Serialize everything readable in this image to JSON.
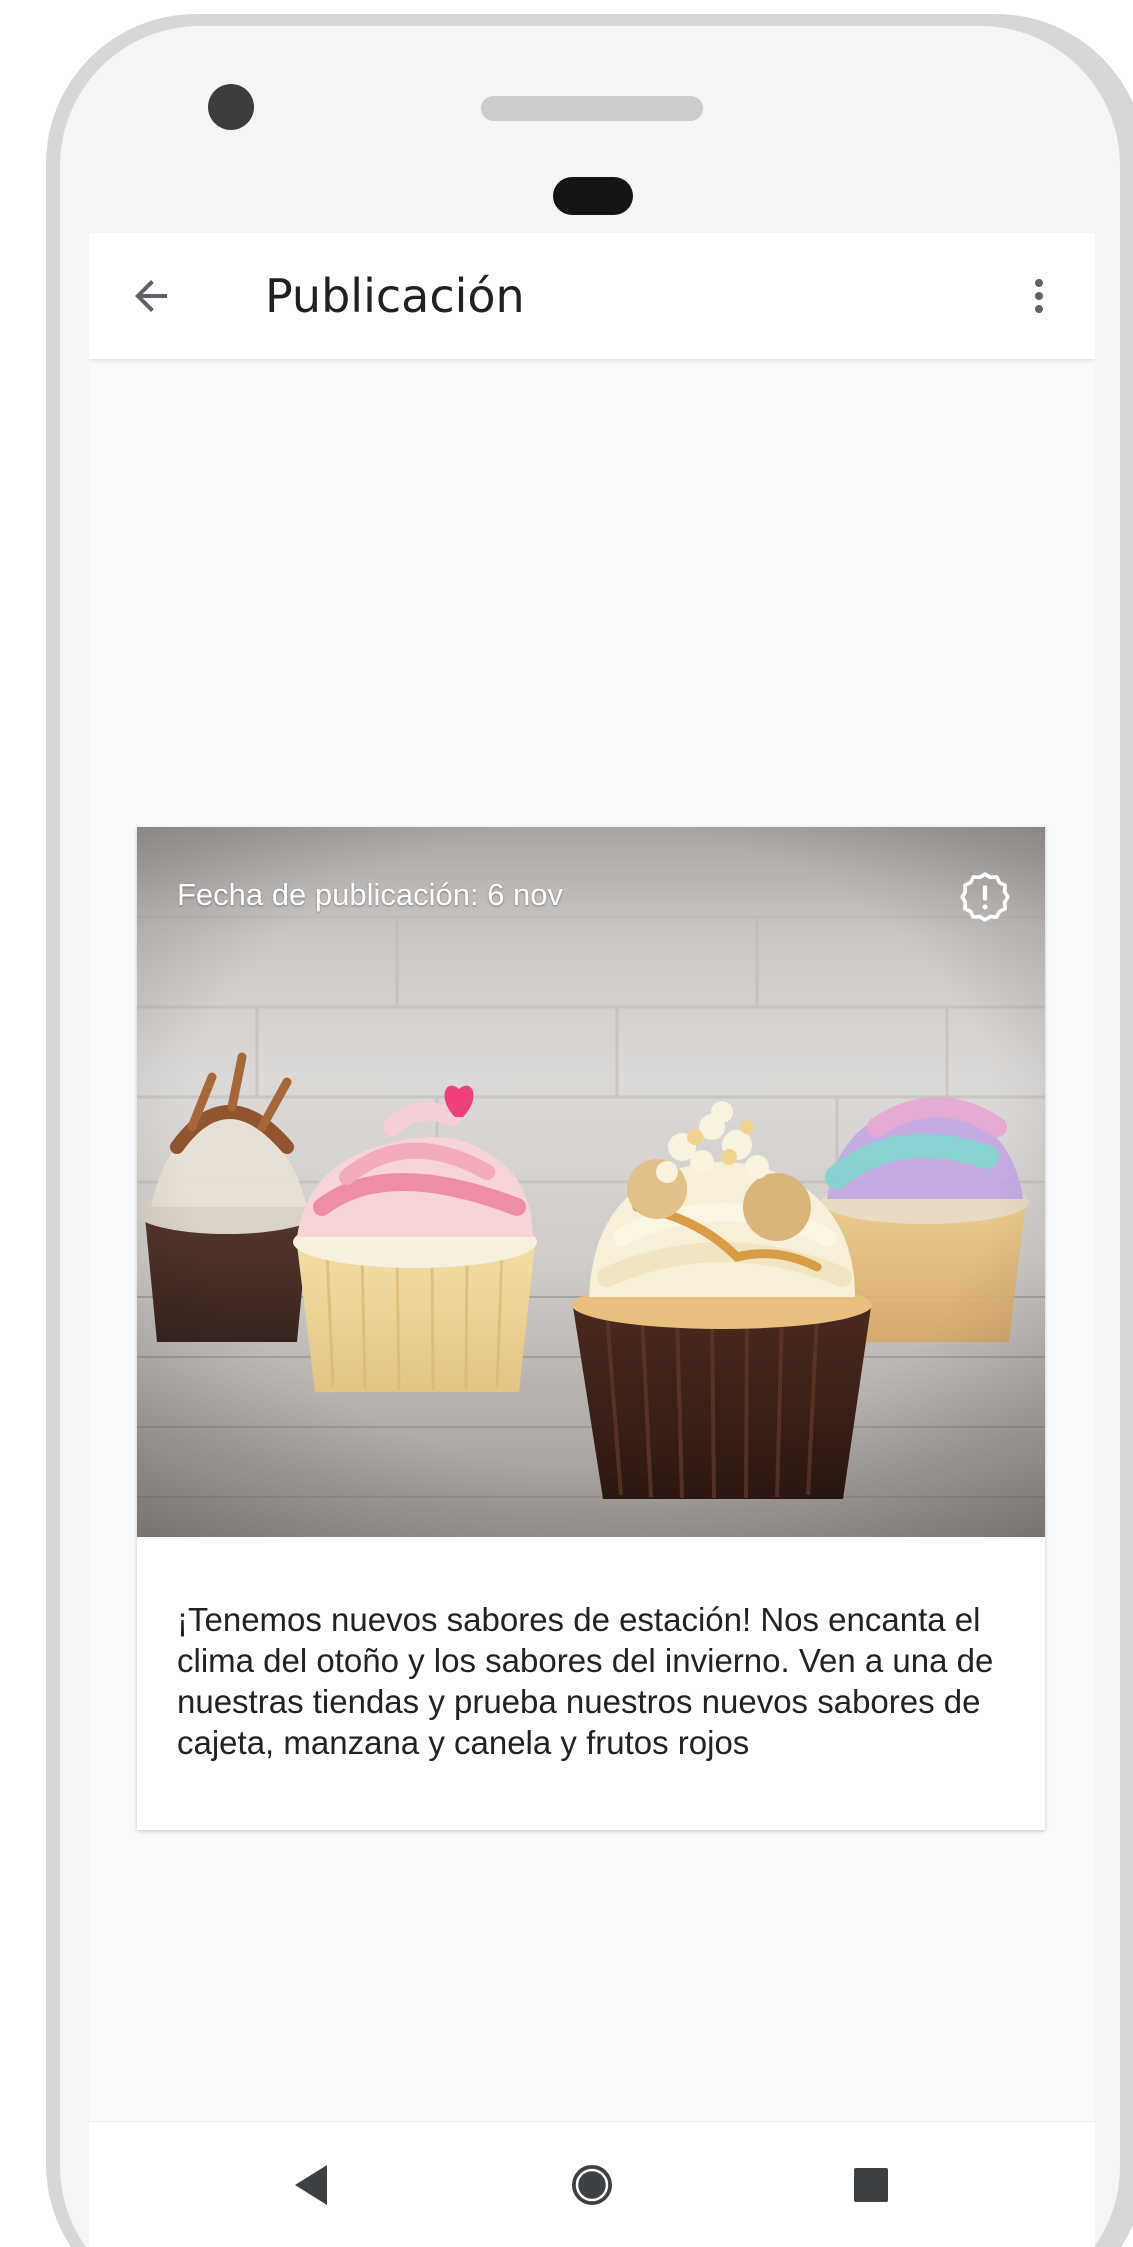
{
  "app_bar": {
    "title": "Publicación",
    "back_icon": "arrow-left-icon",
    "menu_icon": "more-vert-icon"
  },
  "post": {
    "date_label": "Fecha de publicación: 6 nov",
    "report_icon": "alert-badge-icon",
    "image_description_icon": "cupcakes-photo",
    "body": "¡Tenemos nuevos sabores de estación! Nos encanta el clima del otoño y los sabores del invierno. Ven a una de nuestras tiendas y prueba nuestros nuevos sabores de cajeta, manzana y canela y frutos rojos"
  },
  "nav_bar": {
    "back_icon": "triangle-back-icon",
    "home_icon": "circle-home-icon",
    "recents_icon": "square-recents-icon"
  },
  "colors": {
    "frame": "#d6d7d9",
    "screen_bg": "#fafbfc",
    "title_text": "#202124",
    "body_text": "#222222",
    "nav_icon": "#5f6368"
  }
}
